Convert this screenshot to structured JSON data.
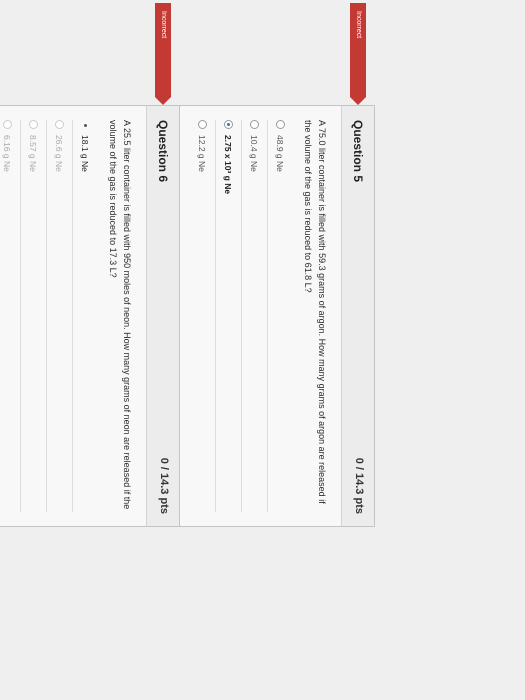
{
  "question5": {
    "badge": "Incorrect",
    "title": "Question 5",
    "points": "0 / 14.3 pts",
    "text": "A 75.0 liter container is filled with 59.3 grams of argon. How many grams of argon are released if the volume of the gas is reduced to 61.8 L?",
    "answers": [
      {
        "label": "48.9 g Ne"
      },
      {
        "label": "10.4 g Ne"
      },
      {
        "label": "2.75 x 10³ g Ne",
        "selected": true
      },
      {
        "label": "12.2 g Ne"
      }
    ]
  },
  "question6": {
    "badge": "Incorrect",
    "title": "Question 6",
    "points": "0 / 14.3 pts",
    "text": "A 25.5 liter container is filled with 950 moles of neon. How many grams of neon are released if the volume of the gas is reduced to 17.3 L?",
    "answers": [
      {
        "label": "18.1 g Ne"
      },
      {
        "label": "26.6 g Ne"
      },
      {
        "label": "8.57 g Ne"
      },
      {
        "label": "6.16 g Ne"
      }
    ]
  }
}
